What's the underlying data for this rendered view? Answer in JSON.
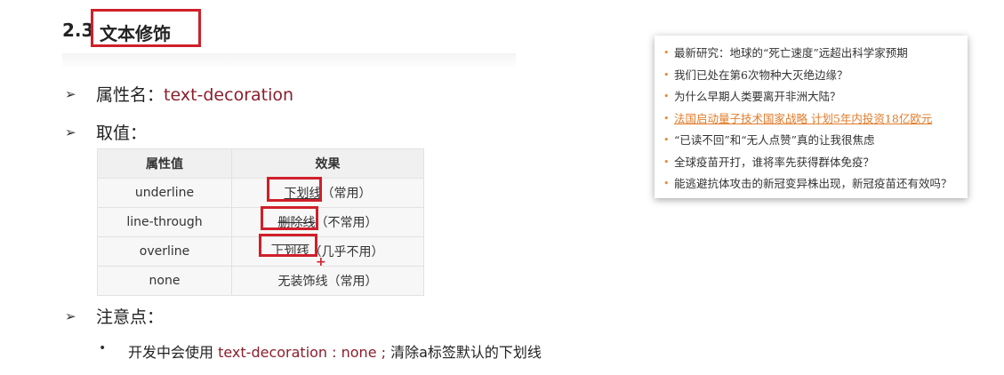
{
  "heading": {
    "number": "2.3",
    "title": "文本修饰"
  },
  "list_marker": "➢",
  "sub_marker": "•",
  "property_row": {
    "label": "属性名：",
    "value": "text-decoration"
  },
  "values_row": {
    "label": "取值："
  },
  "table": {
    "headers": [
      "属性值",
      "效果"
    ],
    "rows": [
      {
        "value": "underline",
        "effect": "下划线",
        "note": "（常用）"
      },
      {
        "value": "line-through",
        "effect": "删除线",
        "note": "（不常用）"
      },
      {
        "value": "overline",
        "effect": "上划线",
        "note": "（几乎不用）"
      },
      {
        "value": "none",
        "effect": "无装饰线",
        "note": "（常用）"
      }
    ]
  },
  "notes_row": {
    "label": "注意点："
  },
  "note": {
    "prefix": "开发中会使用 ",
    "code": "text-decoration : none ;",
    "suffix": " 清除a标签默认的下划线"
  },
  "cursor_glyph": "+",
  "news": {
    "bullet": "•",
    "accent_color": "#e07b2a",
    "items": [
      "最新研究：地球的“死亡速度”远超出科学家预期",
      "我们已处在第6次物种大灭绝边缘？",
      "为什么早期人类要离开非洲大陆？",
      "法国启动量子技术国家战略 计划5年内投资18亿欧元",
      "“已读不回”和“无人点赞”真的让我很焦虑",
      "全球疫苗开打，谁将率先获得群体免疫？",
      "能逃避抗体攻击的新冠变异株出现，新冠疫苗还有效吗？"
    ]
  }
}
